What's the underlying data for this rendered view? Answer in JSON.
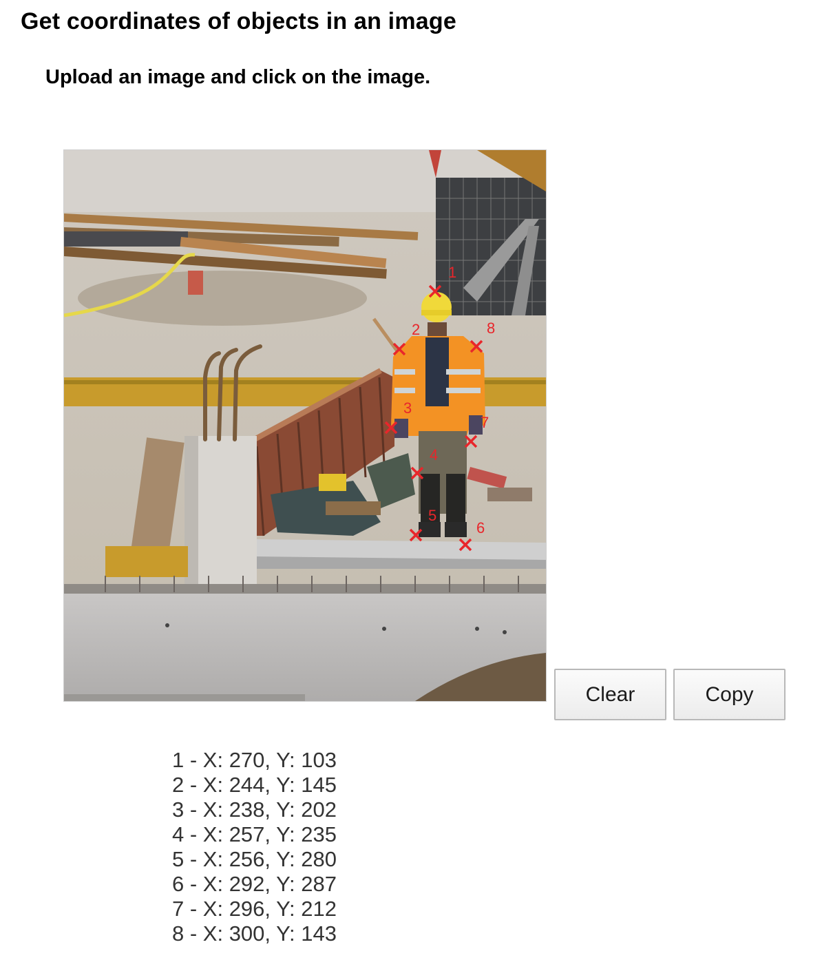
{
  "page": {
    "title": "Get coordinates of objects in an image",
    "instruction": "Upload an image and click on the image."
  },
  "image": {
    "description_icon": "construction-site-photo",
    "marker_color": "#e8262b",
    "markers": [
      {
        "label": "1"
      },
      {
        "label": "2"
      },
      {
        "label": "3"
      },
      {
        "label": "4"
      },
      {
        "label": "5"
      },
      {
        "label": "6"
      },
      {
        "label": "7"
      },
      {
        "label": "8"
      }
    ]
  },
  "buttons": {
    "clear_label": "Clear",
    "copy_label": "Copy"
  },
  "coordinates": [
    "1 - X: 270, Y: 103",
    "2 - X: 244, Y: 145",
    "3 - X: 238, Y: 202",
    "4 - X: 257, Y: 235",
    "5 - X: 256, Y: 280",
    "6 - X: 292, Y: 287",
    "7 - X: 296, Y: 212",
    "8 - X: 300, Y: 143"
  ]
}
